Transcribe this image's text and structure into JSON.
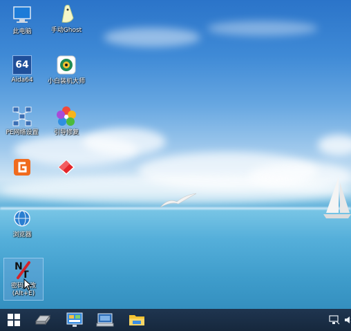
{
  "desktop": {
    "icons": [
      {
        "label": "此电脑",
        "icon": "computer-icon"
      },
      {
        "label": "手动Ghost",
        "icon": "ghost-icon"
      },
      {
        "label": "Aida64",
        "icon": "aida64-icon",
        "badge": "64"
      },
      {
        "label": "小白装机大师",
        "icon": "installer-icon"
      },
      {
        "label": "PE网络设置",
        "icon": "network-settings-icon"
      },
      {
        "label": "引导修复",
        "icon": "boot-repair-icon"
      },
      {
        "label": "浏览器",
        "icon": "browser-icon"
      },
      {
        "label": "密码修改",
        "label2": "(Alt+E)",
        "icon": "password-tool-icon",
        "badge": "NT"
      }
    ]
  },
  "taskbar": {
    "items": [
      "start-icon",
      "drive-icon",
      "control-panel-icon",
      "network-monitor-icon",
      "file-explorer-icon"
    ],
    "tray": [
      "network-icon",
      "volume-icon"
    ]
  },
  "colors": {
    "taskbar": "#16283d",
    "sky": "#3f8ad6",
    "sea": "#3e9ccb"
  }
}
